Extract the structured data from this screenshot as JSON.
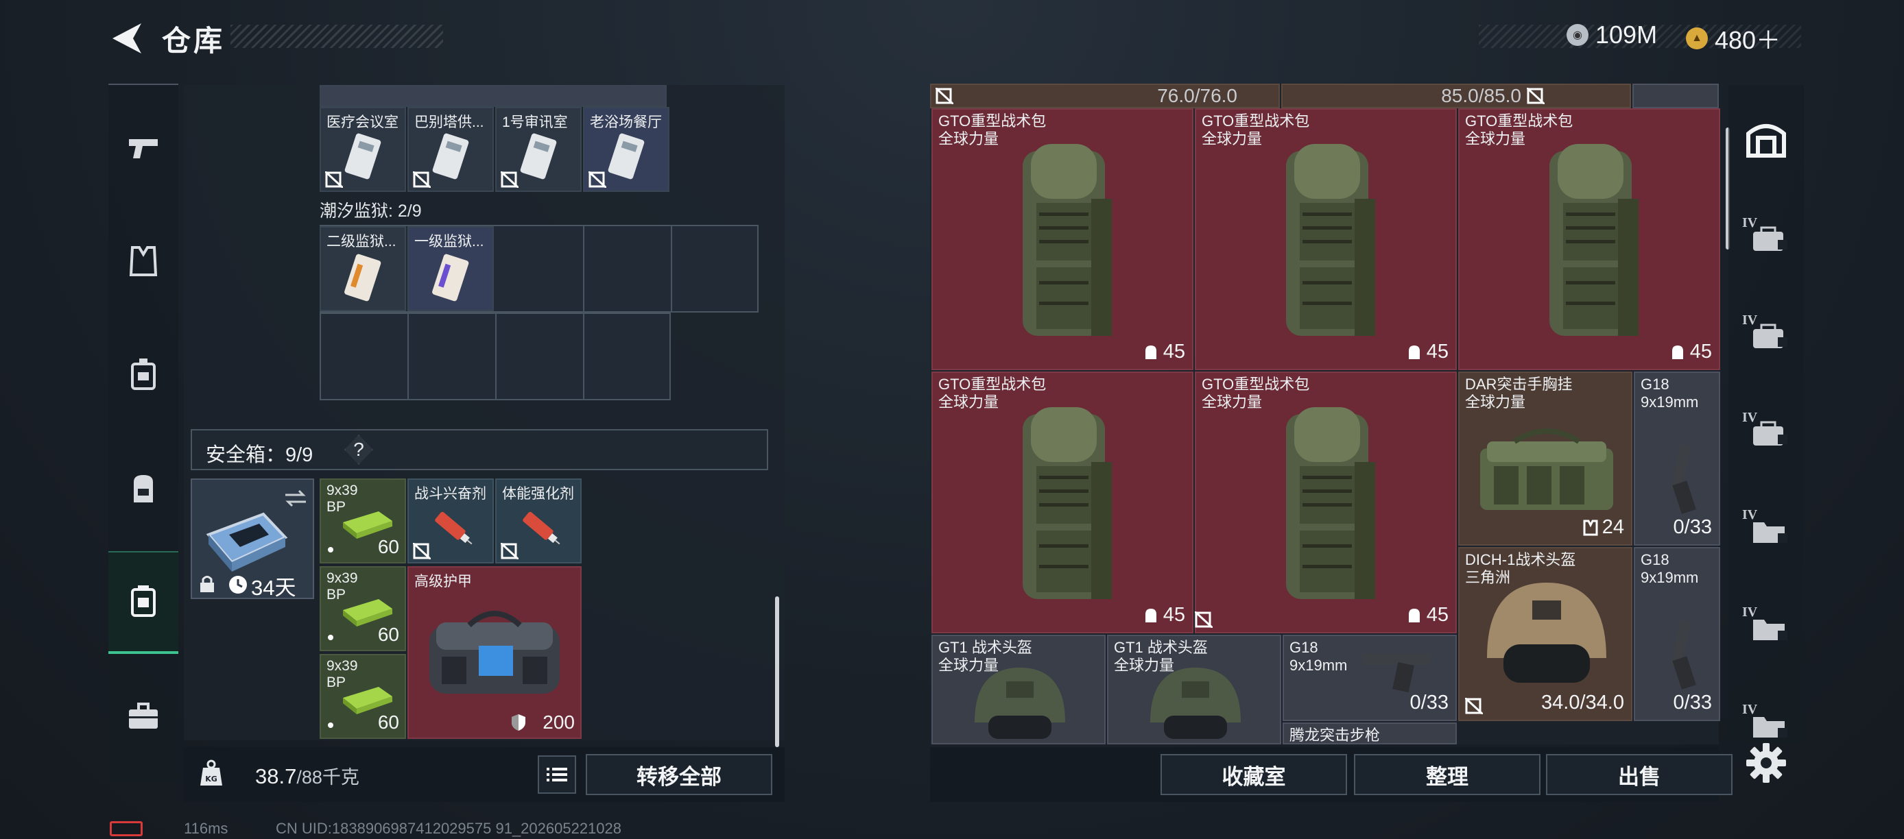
{
  "header": {
    "title": "仓库"
  },
  "currency": [
    {
      "icon": "silver-coin-icon",
      "value": "109M"
    },
    {
      "icon": "gold-coin-icon",
      "value": "480＋"
    }
  ],
  "rail": [
    {
      "icon": "pistol-icon",
      "active": false
    },
    {
      "icon": "armor-vest-icon",
      "active": false
    },
    {
      "icon": "chest-rig-icon",
      "active": false
    },
    {
      "icon": "backpack-icon",
      "active": false
    },
    {
      "icon": "safe-box-icon",
      "active": true
    },
    {
      "icon": "briefcase-icon",
      "active": false
    }
  ],
  "keycards": [
    {
      "label": "医疗会议室"
    },
    {
      "label": "巴别塔供..."
    },
    {
      "label": "1号审讯室"
    },
    {
      "label": "老浴场餐厅"
    }
  ],
  "prison": {
    "label": "潮汐监狱: 2/9",
    "cards": [
      {
        "label": "二级监狱..."
      },
      {
        "label": "一级监狱..."
      }
    ]
  },
  "safe": {
    "label": "安全箱：9/9",
    "help": "?",
    "box_timer": "34天",
    "items": [
      {
        "name": "9x39",
        "sub": "BP",
        "count": "60"
      },
      {
        "name": "9x39",
        "sub": "BP",
        "count": "60"
      },
      {
        "name": "9x39",
        "sub": "BP",
        "count": "60"
      },
      {
        "name": "战斗兴奋剂"
      },
      {
        "name": "体能强化剂"
      },
      {
        "name": "高级护甲",
        "durability": "200"
      }
    ]
  },
  "weight": {
    "value": "38.7",
    "max": "/88千克"
  },
  "left_buttons": {
    "transfer_all": "转移全部"
  },
  "stash": {
    "top_values": [
      "76.0/76.0",
      "85.0/85.0"
    ],
    "items": [
      {
        "name": "GTO重型战术包",
        "sub": "全球力量",
        "count": "45"
      },
      {
        "name": "GTO重型战术包",
        "sub": "全球力量",
        "count": "45"
      },
      {
        "name": "GTO重型战术包",
        "sub": "全球力量",
        "count": "45"
      },
      {
        "name": "GTO重型战术包",
        "sub": "全球力量",
        "count": "45"
      },
      {
        "name": "GTO重型战术包",
        "sub": "全球力量",
        "count": "45"
      },
      {
        "name": "DAR突击手胸挂",
        "sub": "全球力量",
        "count": "24"
      },
      {
        "name": "G18",
        "sub": "9x19mm",
        "count": "0/33"
      },
      {
        "name": "DICH-1战术头盔",
        "sub": "三角洲",
        "count": "34.0/34.0"
      },
      {
        "name": "G18",
        "sub": "9x19mm",
        "count": "0/33"
      },
      {
        "name": "GT1 战术头盔",
        "sub": "全球力量"
      },
      {
        "name": "GT1 战术头盔",
        "sub": "全球力量"
      },
      {
        "name": "G18",
        "sub": "9x19mm",
        "count": "0/33"
      },
      {
        "name": "腾龙突击步枪"
      }
    ]
  },
  "right_buttons": {
    "collection": "收藏室",
    "sort": "整理",
    "sell": "出售"
  },
  "side_tabs": [
    {
      "icon": "warehouse-icon"
    },
    {
      "icon": "IV"
    },
    {
      "icon": "IV"
    },
    {
      "icon": "IV"
    },
    {
      "icon": "IV"
    },
    {
      "icon": "IV"
    },
    {
      "icon": "IV"
    }
  ],
  "status": {
    "ping": "116ms",
    "uid": "CN UID:1838906987412029575 91_202605221028"
  },
  "colors": {
    "accent": "#3ec28f",
    "stash_red": "#6b2a36",
    "gold": "#d9a93b"
  }
}
